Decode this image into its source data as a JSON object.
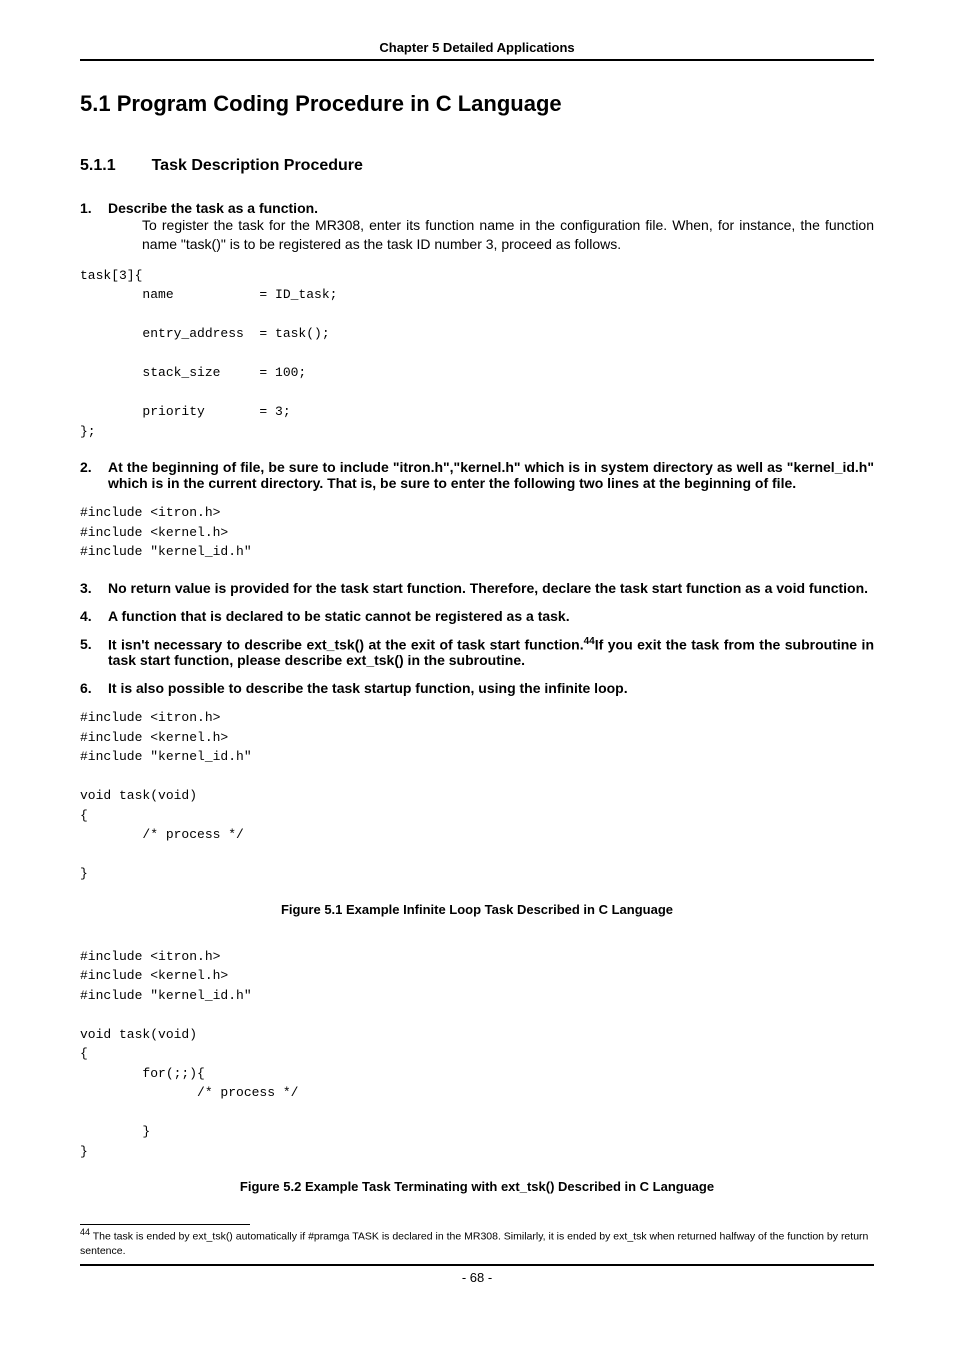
{
  "header": "Chapter 5 Detailed Applications",
  "section_title": "5.1  Program Coding Procedure in C Language",
  "subsection_num": "5.1.1",
  "subsection_title": "Task Description Procedure",
  "items": {
    "i1": {
      "num": "1.",
      "head": "Describe the task as a function.",
      "body": "To register the task for the MR308, enter its function name in the configuration file. When, for instance, the function name \"task()\" is to be registered as the task ID number 3, proceed as follows."
    },
    "i2": {
      "num": "2.",
      "head": "At the beginning of file, be sure to include \"itron.h\",\"kernel.h\" which is in system directory as well as \"kernel_id.h\" which is in the current directory. That is, be sure to enter the following two lines at the beginning of file."
    },
    "i3": {
      "num": "3.",
      "head": "No return value is provided for the task start function. Therefore, declare the task start function as a void function."
    },
    "i4": {
      "num": "4.",
      "head": "A function that is declared to be static cannot be registered as a task."
    },
    "i5": {
      "num": "5.",
      "head_a": "It isn't necessary to describe ext_tsk() at the exit of task start function.",
      "fn_ref": "44",
      "head_b": "If you exit the task from the subroutine in task start function,   please describe ext_tsk() in the subroutine."
    },
    "i6": {
      "num": "6.",
      "head": "It is also possible to describe the task startup function, using the infinite loop."
    }
  },
  "code1": "task[3]{\n        name           = ID_task;\n\n        entry_address  = task();\n\n        stack_size     = 100;\n\n        priority       = 3;\n};",
  "code2": "#include <itron.h>\n#include <kernel.h>\n#include \"kernel_id.h\"",
  "code3": "#include <itron.h>\n#include <kernel.h>\n#include \"kernel_id.h\"\n\nvoid task(void)\n{\n        /* process */\n\n}",
  "code4": "#include <itron.h>\n#include <kernel.h>\n#include \"kernel_id.h\"\n\nvoid task(void)\n{\n        for(;;){\n               /* process */\n\n        }\n}",
  "caption1": "Figure 5.1 Example Infinite Loop Task Described in C Language",
  "caption2": "Figure 5.2 Example Task Terminating with ext_tsk() Described in C Language",
  "footnote": {
    "ref": "44",
    "text": " The task is ended by ext_tsk() automatically if #pramga TASK is declared in the MR308. Similarly, it is ended by ext_tsk when returned halfway of the function by return sentence."
  },
  "page_num": "- 68 -"
}
